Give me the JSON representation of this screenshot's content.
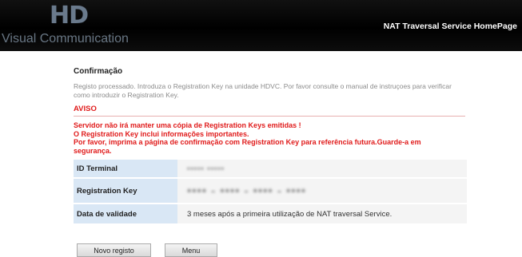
{
  "header": {
    "logo_main": "HD",
    "logo_sub": "Visual Communication",
    "link": "NAT Traversal Service HomePage"
  },
  "confirmation": {
    "title": "Confirmação",
    "text": "Registo processado. Introduza o Registration Key na unidade HDVC. Por favor consulte o manual de instruçoes para verificar como introduzir o Registration Key."
  },
  "aviso": {
    "title": "AVISO",
    "lines": [
      "Servidor não irá manter uma cópia de Registration Keys emitidas !",
      "O Registration Key inclui informações importantes.",
      "Por favor, imprima a página de confirmação com Registration Key para referência futura.Guarde-a em segurança."
    ]
  },
  "info": {
    "terminal_label": "ID Terminal",
    "terminal_value": "••••• •••••",
    "key_label": "Registration Key",
    "key_value": "•••• - •••• - •••• - ••••",
    "validity_label": "Data de validade",
    "validity_value": "3 meses após a primeira utilização de NAT traversal Service."
  },
  "buttons": {
    "new_registration": "Novo registo",
    "menu": "Menu"
  }
}
